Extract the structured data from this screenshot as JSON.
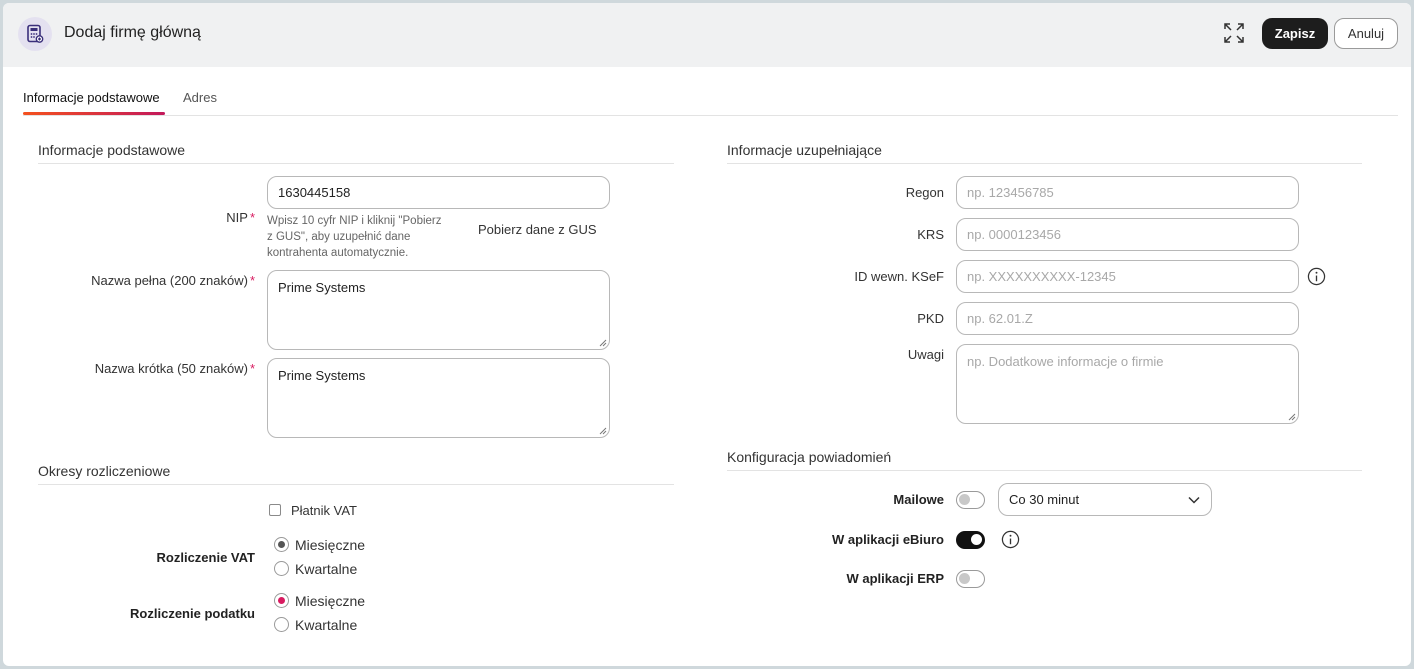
{
  "header": {
    "title": "Dodaj firmę główną",
    "save_label": "Zapisz",
    "cancel_label": "Anuluj"
  },
  "tabs": [
    {
      "label": "Informacje podstawowe",
      "active": true
    },
    {
      "label": "Adres",
      "active": false
    }
  ],
  "basic": {
    "section_title": "Informacje podstawowe",
    "nip": {
      "label": "NIP",
      "value": "1630445158",
      "hint_line1": "Wpisz 10 cyfr NIP i kliknij \"Pobierz",
      "hint_line2": "z GUS\", aby uzupełnić dane",
      "hint_line3": "kontrahenta automatycznie.",
      "gus_link": "Pobierz dane z GUS"
    },
    "full_name": {
      "label": "Nazwa pełna (200 znaków)",
      "value": "Prime Systems"
    },
    "short_name": {
      "label": "Nazwa krótka (50 znaków)",
      "value": "Prime Systems"
    },
    "required_mark": "*"
  },
  "periods": {
    "section_title": "Okresy rozliczeniowe",
    "vat_payer_label": "Płatnik VAT",
    "vat_payer_checked": false,
    "vat": {
      "label": "Rozliczenie VAT",
      "options": [
        "Miesięczne",
        "Kwartalne"
      ],
      "selected": "Miesięczne"
    },
    "tax": {
      "label": "Rozliczenie podatku",
      "options": [
        "Miesięczne",
        "Kwartalne"
      ],
      "selected": "Miesięczne"
    }
  },
  "extra": {
    "section_title": "Informacje uzupełniające",
    "regon": {
      "label": "Regon",
      "placeholder": "np. 123456785"
    },
    "krs": {
      "label": "KRS",
      "placeholder": "np. 0000123456"
    },
    "ksef": {
      "label": "ID wewn. KSeF",
      "placeholder": "np. XXXXXXXXXX-12345"
    },
    "pkd": {
      "label": "PKD",
      "placeholder": "np. 62.01.Z"
    },
    "notes": {
      "label": "Uwagi",
      "placeholder": "np. Dodatkowe informacje o firmie"
    }
  },
  "notifications": {
    "section_title": "Konfiguracja powiadomień",
    "email": {
      "label": "Mailowe",
      "enabled": false,
      "frequency": "Co 30 minut"
    },
    "app": {
      "label": "W aplikacji eBiuro",
      "enabled": true
    },
    "erp": {
      "label": "W aplikacji ERP",
      "enabled": false
    }
  },
  "colors": {
    "primary_button": "#1d1d1d",
    "required": "#d81b60",
    "tab_gradient_start": "#f4511e",
    "tab_gradient_end": "#c2185b"
  }
}
